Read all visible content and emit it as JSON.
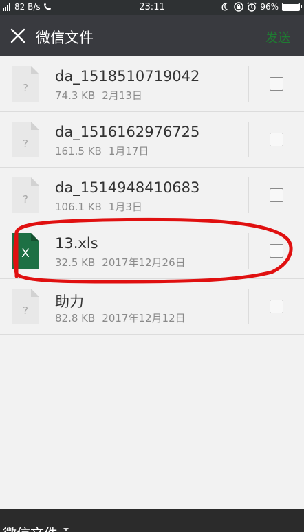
{
  "status_bar": {
    "network": "82 B/s",
    "time": "23:11",
    "battery": "96%",
    "battery_level": 0.96,
    "icons": [
      "signal-icon",
      "call-icon",
      "do-not-disturb-icon",
      "lock-rotation-icon",
      "alarm-icon",
      "battery-icon"
    ]
  },
  "header": {
    "title": "微信文件",
    "send_label": "发送"
  },
  "files": [
    {
      "name": "da_1518510719042",
      "size": "74.3 KB",
      "date": "2月13日",
      "icon": "unknown-file-icon"
    },
    {
      "name": "da_1516162976725",
      "size": "161.5 KB",
      "date": "1月17日",
      "icon": "unknown-file-icon"
    },
    {
      "name": "da_1514948410683",
      "size": "106.1 KB",
      "date": "1月3日",
      "icon": "unknown-file-icon"
    },
    {
      "name": "13.xls",
      "size": "32.5 KB",
      "date": "2017年12月26日",
      "icon": "excel-file-icon",
      "icon_letter": "X"
    },
    {
      "name": "助力",
      "size": "82.8 KB",
      "date": "2017年12月12日",
      "icon": "unknown-file-icon"
    }
  ],
  "file_placeholder_glyph": "?",
  "bottom": {
    "folder_label": "微信文件"
  },
  "colors": {
    "status_bar": "#2e3133",
    "title_bar": "#393a3f",
    "send_text": "#1f7a32",
    "highlight": "#e01010",
    "excel_green": "#1d7044"
  }
}
